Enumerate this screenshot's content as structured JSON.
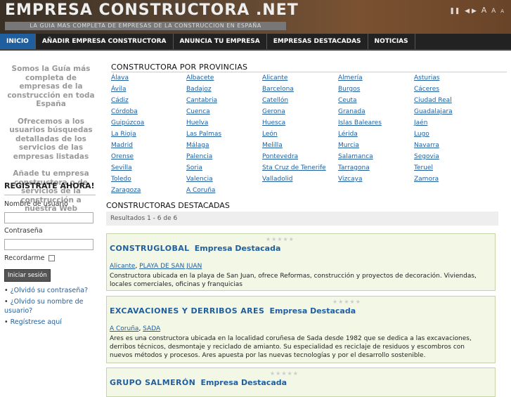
{
  "header": {
    "title": "EMPRESA CONSTRUCTORA .NET",
    "tagline": "LA GUIA MAS COMPLETA DE EMPRESAS DE LA CONSTRUCCION EN ESPAÑA",
    "font_tools": [
      "❚❚",
      "◀ ▶",
      "A",
      "A",
      "A"
    ]
  },
  "nav": {
    "items": [
      "INICIO",
      "AÑADIR EMPRESA CONSTRUCTORA",
      "ANUNCIA TU EMPRESA",
      "EMPRESAS DESTACADAS",
      "NOTICIAS"
    ]
  },
  "sidebar": {
    "intro": [
      "Somos la Guía más completa de empresas de la construcción en toda España",
      "Ofrecemos a los usuarios búsquedas detalladas de los servicios de las empresas listadas",
      "Añade tu empresa constructora o de servicios de la construcción a nuestra Web"
    ],
    "login": {
      "title": "REGISTRATE AHORA!",
      "username_label": "Nombre de usuario",
      "password_label": "Contraseña",
      "remember_label": "Recordarme",
      "submit_label": "Iniciar sesión",
      "links": [
        "¿Olvidó su contraseña?",
        "¿Olvido su nombre de usuario?",
        "Regístrese aquí"
      ]
    }
  },
  "main": {
    "provinces_title": "CONSTRUCTORA POR PROVINCIAS",
    "provinces": [
      [
        "Álava",
        "Albacete",
        "Alicante",
        "Almería",
        "Asturias"
      ],
      [
        "Ávila",
        "Badajoz",
        "Barcelona",
        "Burgos",
        "Cáceres"
      ],
      [
        "Cádiz",
        "Cantabria",
        "Catellón",
        "Ceuta",
        "Ciudad Real"
      ],
      [
        "Córdoba",
        "Cuenca",
        "Gerona",
        "Granada",
        "Guadalajara"
      ],
      [
        "Guipúzcoa",
        "Huelva",
        "Huesca",
        "Islas Baleares",
        "Jaén"
      ],
      [
        "La Rioja",
        "Las Palmas",
        "León",
        "Lérida",
        "Lugo"
      ],
      [
        "Madrid",
        "Málaga",
        "Melilla",
        "Murcia",
        "Navarra"
      ],
      [
        "Orense",
        "Palencia",
        "Pontevedra",
        "Salamanca",
        "Segovia"
      ],
      [
        "Sevilla",
        "Soria",
        "Sta Cruz de Tenerife",
        "Tarragona",
        "Teruel"
      ],
      [
        "Toledo",
        "Valencia",
        "Valladolid",
        "Vizcaya",
        "Zamora"
      ],
      [
        "Zaragoza",
        "A Coruña"
      ]
    ],
    "featured_title": "CONSTRUCTORAS DESTACADAS",
    "results_text": "Resultados 1 - 6 de 6",
    "stars": "★★★★★",
    "featured_tag": "Empresa Destacada",
    "companies": [
      {
        "name": "CONSTRUGLOBAL",
        "location": [
          "Alicante",
          "PLAYA DE SAN JUAN"
        ],
        "description": "Constructora ubicada en la playa de San Juan, ofrece Reformas, construcción y proyectos de decoración. Viviendas, locales comerciales, oficinas y franquicias"
      },
      {
        "name": "EXCAVACIONES Y DERRIBOS ARES",
        "location": [
          "A Coruña",
          "SADA"
        ],
        "description": "Ares es una constructora ubicada en la localidad coruñesa de Sada desde 1982 que se dedica a las excavaciones, derribos técnicos, desmontaje y reciclado de amianto. Su especialidad es reciclaje de residuos y escombros con nuevos métodos y procesos. Ares apuesta por las nuevas tecnologías y por el desarrollo sostenible."
      },
      {
        "name": "GRUPO SALMERÓN",
        "location": [],
        "description": ""
      }
    ]
  }
}
